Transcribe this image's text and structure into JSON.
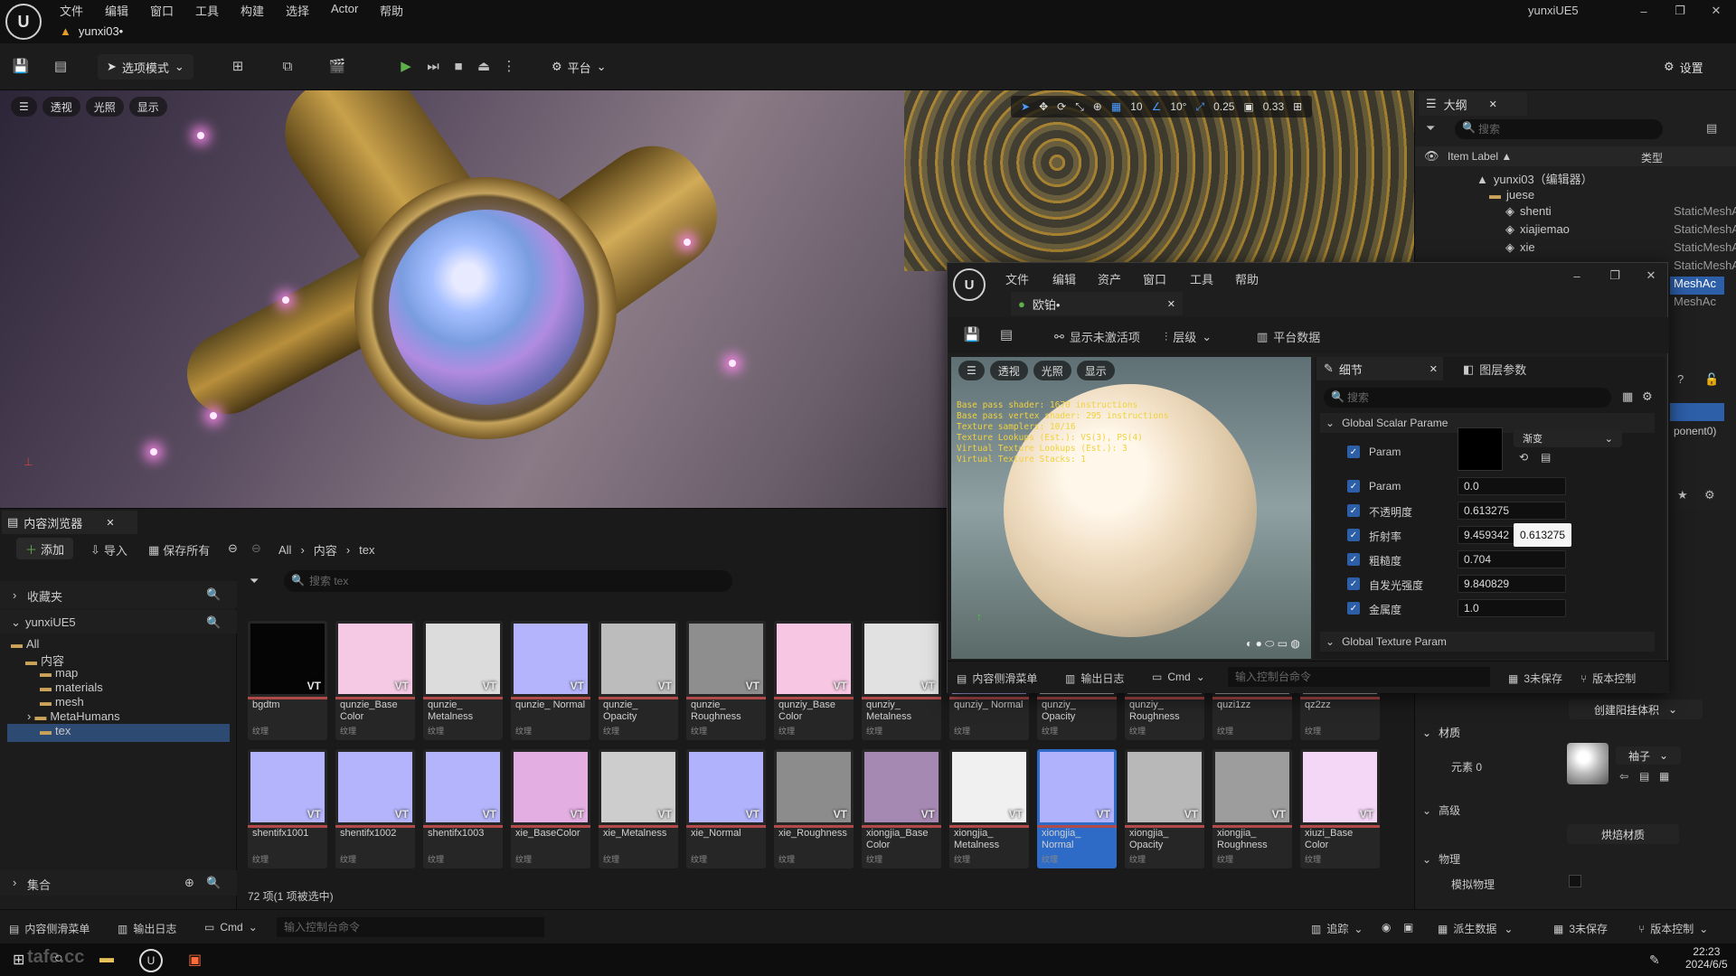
{
  "app": {
    "menu": [
      "文件",
      "编辑",
      "窗口",
      "工具",
      "构建",
      "选择",
      "Actor",
      "帮助"
    ],
    "tab_title": "yunxi03•",
    "project_name": "yunxiUE5",
    "window_controls": {
      "minimize": "–",
      "restore": "❐",
      "close": "✕"
    },
    "settings_label": "设置"
  },
  "toolbar": {
    "mode_label": "选项模式",
    "platform_label": "平台"
  },
  "viewport": {
    "buttons": [
      "透视",
      "光照",
      "显示"
    ],
    "grid_snap": "10",
    "rot_snap": "10°",
    "scale_snap": "0.25",
    "camera_speed": "0.33"
  },
  "outliner": {
    "title": "大纲",
    "search_placeholder": "搜索",
    "col_label": "Item Label ▲",
    "col_type": "类型",
    "rows": [
      {
        "label": "yunxi03（编辑器）",
        "type": ""
      },
      {
        "label": "juese",
        "type": ""
      },
      {
        "label": "shenti",
        "type": "StaticMeshAc"
      },
      {
        "label": "xiajiemao",
        "type": "StaticMeshAc"
      },
      {
        "label": "xie",
        "type": "StaticMeshAc"
      }
    ],
    "partial_types": [
      "MeshAc",
      "MeshAc"
    ]
  },
  "material_editor": {
    "menu": [
      "文件",
      "编辑",
      "资产",
      "窗口",
      "工具",
      "帮助"
    ],
    "tab_title": "欧铂•",
    "toolbar": [
      "显示未激活项",
      "层级",
      "平台数据"
    ],
    "preview_buttons": [
      "透视",
      "光照",
      "显示"
    ],
    "stats": [
      "Base pass shader: 1670 instructions",
      "Base pass vertex shader: 295 instructions",
      "Texture samplers: 10/16",
      "Texture Lookups (Est.): VS(3), PS(4)",
      "Virtual Texture Lookups (Est.): 3",
      "Virtual Texture Stacks: 1"
    ],
    "details_tab": "细节",
    "layer_tab": "图层参数",
    "search_placeholder": "搜索",
    "scalar_group": "Global Scalar Parame",
    "texture_group": "Global Texture Param",
    "gradient_dropdown": "渐变",
    "params": [
      {
        "name": "Param",
        "value": "0.0"
      },
      {
        "name": "不透明度",
        "value": "0.613275"
      },
      {
        "name": "折射率",
        "value": "9.459342"
      },
      {
        "name": "粗糙度",
        "value": "0.704"
      },
      {
        "name": "自发光强度",
        "value": "9.840829"
      },
      {
        "name": "金属度",
        "value": "1.0"
      }
    ],
    "color_param_name": "Param",
    "tooltip": "0.613275",
    "bottom": [
      "内容侧滑菜单",
      "输出日志",
      "Cmd"
    ],
    "console_placeholder": "输入控制台命令",
    "unsaved": "3未保存",
    "version_control": "版本控制"
  },
  "right_panel": {
    "partial_text": "ponent0)",
    "lod_button": "创建阳挂体积",
    "material_section": "材质",
    "element_label": "元素 0",
    "element_dropdown": "袖子",
    "advanced_section": "高级",
    "bake_button": "烘焙材质",
    "physics_section": "物理",
    "simulate_label": "模拟物理"
  },
  "content_browser": {
    "title": "内容浏览器",
    "add_label": "添加",
    "import_label": "导入",
    "save_all_label": "保存所有",
    "breadcrumb": [
      "All",
      "内容",
      "tex"
    ],
    "favorites_label": "收藏夹",
    "project_label": "yunxiUE5",
    "tree": [
      "All",
      "内容",
      "map",
      "materials",
      "mesh",
      "MetaHumans",
      "tex"
    ],
    "collections_label": "集合",
    "search_placeholder": "搜索 tex",
    "status": "72 项(1 项被选中)",
    "type_label": "纹理",
    "vt_label": "VT",
    "row1": [
      {
        "name": "bgdtm",
        "color": "#050505"
      },
      {
        "name": "qunzie_Base Color",
        "color": "#f5c9e4"
      },
      {
        "name": "qunzie_ Metalness",
        "color": "#dcdcdc"
      },
      {
        "name": "qunzie_ Normal",
        "color": "#b3b4fb"
      },
      {
        "name": "qunzie_ Opacity",
        "color": "#bcbcbc"
      },
      {
        "name": "qunzie_ Roughness",
        "color": "#8e8e8e"
      },
      {
        "name": "qunziy_Base Color",
        "color": "#f7c6e2"
      },
      {
        "name": "qunziy_ Metalness",
        "color": "#e1e1e1"
      },
      {
        "name": "qunziy_ Normal",
        "color": "#b6b6fb"
      },
      {
        "name": "qunziy_ Opacity",
        "color": "#d6d6d6"
      },
      {
        "name": "qunziy_ Roughness",
        "color": "#9a9a9a"
      },
      {
        "name": "quzi1zz",
        "color": "#c6c6c6"
      },
      {
        "name": "qz2zz",
        "color": "#bdbdbd"
      }
    ],
    "row2": [
      {
        "name": "shentifx1001",
        "color": "#b3b4fb"
      },
      {
        "name": "shentifx1002",
        "color": "#b3b4fb"
      },
      {
        "name": "shentifx1003",
        "color": "#b3b4fb"
      },
      {
        "name": "xie_BaseColor",
        "color": "#e3aee2"
      },
      {
        "name": "xie_Metalness",
        "color": "#cdcdcd"
      },
      {
        "name": "xie_Normal",
        "color": "#b1b2fc"
      },
      {
        "name": "xie_Roughness",
        "color": "#8c8c8c"
      },
      {
        "name": "xiongjia_Base Color",
        "color": "#a689b2"
      },
      {
        "name": "xiongjia_ Metalness",
        "color": "#f0f0f0"
      },
      {
        "name": "xiongjia_ Normal",
        "color": "#b1b2fc"
      },
      {
        "name": "xiongjia_ Opacity",
        "color": "#b8b8b8"
      },
      {
        "name": "xiongjia_ Roughness",
        "color": "#9d9d9d"
      },
      {
        "name": "xiuzi_Base Color",
        "color": "#f4d6f6"
      }
    ],
    "selected": "xiongjia_ Normal"
  },
  "status_bar": {
    "left": [
      "内容侧滑菜单",
      "输出日志",
      "Cmd"
    ],
    "console_placeholder": "输入控制台命令",
    "right": [
      "追踪",
      "派生数据",
      "3未保存",
      "版本控制"
    ]
  },
  "taskbar": {
    "time": "22:23",
    "date": "2024/6/5",
    "watermark": "tafe.cc"
  }
}
